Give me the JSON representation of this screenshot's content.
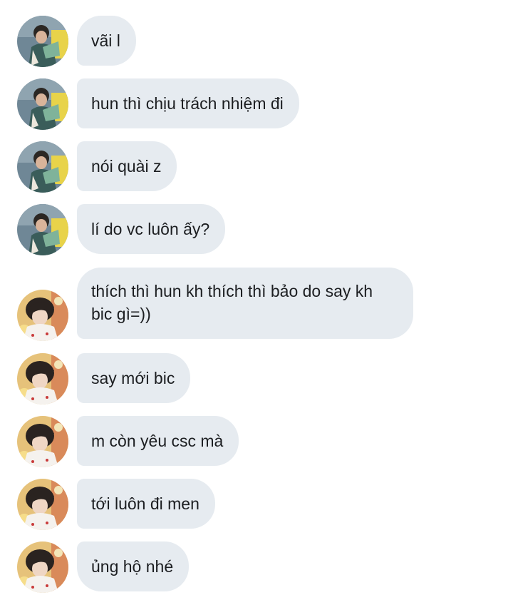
{
  "messages": [
    {
      "text": "vãi l",
      "sender": "contact_a"
    },
    {
      "text": "hun thì chịu trách nhiệm đi",
      "sender": "contact_a"
    },
    {
      "text": "nói quài z",
      "sender": "contact_a"
    },
    {
      "text": "lí do vc luôn ấy?",
      "sender": "contact_a"
    },
    {
      "text": "thích thì hun kh thích thì bảo do say kh bic gì=))",
      "sender": "contact_b"
    },
    {
      "text": "say mới bic",
      "sender": "contact_b"
    },
    {
      "text": "m còn yêu csc mà",
      "sender": "contact_b"
    },
    {
      "text": "tới luôn đi men",
      "sender": "contact_b"
    },
    {
      "text": "ủng hộ nhé",
      "sender": "contact_b"
    }
  ],
  "colors": {
    "bubble_bg": "#e6ebf0",
    "text": "#1c1e21",
    "background": "#ffffff"
  }
}
